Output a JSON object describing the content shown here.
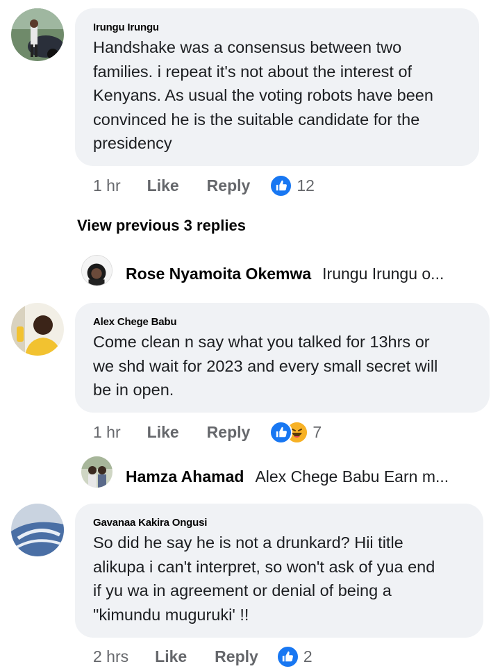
{
  "comments": [
    {
      "author": "Irungu Irungu",
      "text": "Handshake was a consensus between two\nfamilies. i repeat it's not about the interest of\nKenyans. As usual the voting robots have been\nconvinced he is the suitable candidate for the\npresidency",
      "time": "1 hr",
      "like_label": "Like",
      "reply_label": "Reply",
      "reaction_count": "12",
      "reactions": [
        "like-icon"
      ]
    },
    {
      "author": "Alex Chege Babu",
      "text": "Come clean n say what you talked for 13hrs or\nwe shd wait for 2023 and every small secret will\nbe in open.",
      "time": "1 hr",
      "like_label": "Like",
      "reply_label": "Reply",
      "reaction_count": "7",
      "reactions": [
        "like-icon",
        "haha-icon"
      ]
    },
    {
      "author": "Gavanaa Kakira Ongusi",
      "text": "So did he say he is not a drunkard? Hii title\nalikupa i can't interpret, so won't ask of yua end\nif yu wa in agreement or denial of being a\n\"kimundu muguruki' !!",
      "time": "2 hrs",
      "like_label": "Like",
      "reply_label": "Reply",
      "reaction_count": "2",
      "reactions": [
        "like-icon"
      ]
    }
  ],
  "view_previous": "View previous 3 replies",
  "replies": [
    {
      "author": "Rose Nyamoita Okemwa",
      "preview": "Irungu Irungu o..."
    },
    {
      "author": "Hamza Ahamad",
      "preview": "Alex Chege Babu Earn m..."
    }
  ],
  "colors": {
    "bubble": "#f0f2f5",
    "like_blue": "#1877f2",
    "meta_gray": "#65676b"
  }
}
